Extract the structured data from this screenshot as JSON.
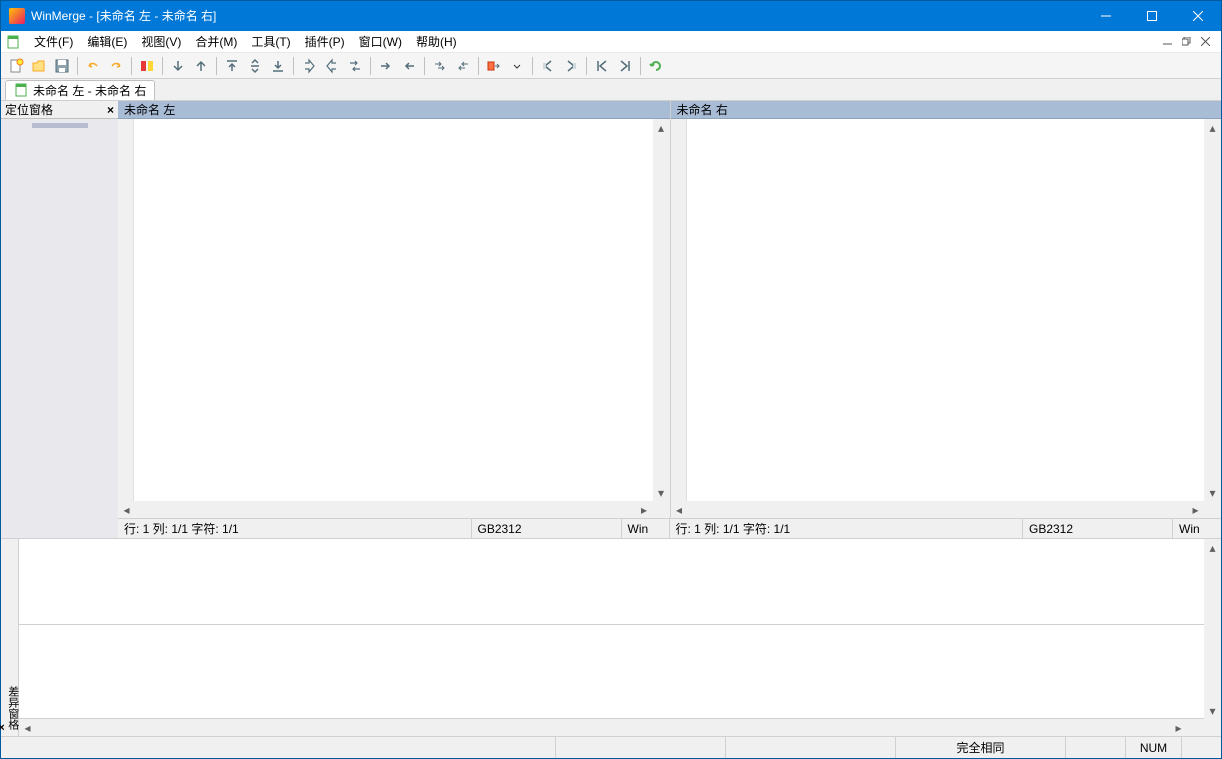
{
  "titlebar": {
    "app": "WinMerge",
    "doc": "[未命名 左 - 未命名 右]"
  },
  "menu": {
    "file": "文件(F)",
    "edit": "编辑(E)",
    "view": "视图(V)",
    "merge": "合并(M)",
    "tools": "工具(T)",
    "plugins": "插件(P)",
    "window": "窗口(W)",
    "help": "帮助(H)"
  },
  "doc_tab": "未命名 左 - 未命名 右",
  "loc_pane": {
    "title": "定位窗格"
  },
  "panes": {
    "left": {
      "title": "未命名 左",
      "status_pos": "行: 1  列: 1/1  字符: 1/1",
      "status_enc": "GB2312",
      "status_eol": "Win"
    },
    "right": {
      "title": "未命名 右",
      "status_pos": "行: 1  列: 1/1  字符: 1/1",
      "status_enc": "GB2312",
      "status_eol": "Win"
    }
  },
  "diff_pane": {
    "label": "差异窗格"
  },
  "statusbar": {
    "compare_result": "完全相同",
    "num": "NUM"
  }
}
